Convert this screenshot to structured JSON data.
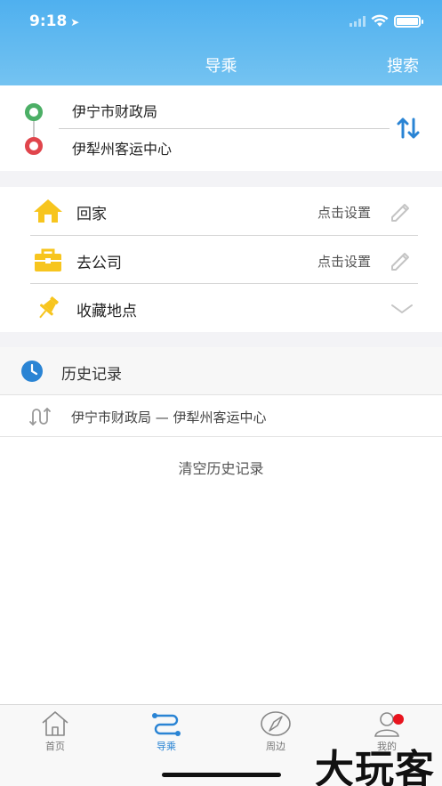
{
  "status_bar": {
    "time": "9:18"
  },
  "header": {
    "title": "导乘",
    "search_label": "搜索"
  },
  "route": {
    "from": "伊宁市财政局",
    "to": "伊犁州客运中心"
  },
  "places": [
    {
      "label": "回家",
      "action": "点击设置",
      "icon": "home-icon"
    },
    {
      "label": "去公司",
      "action": "点击设置",
      "icon": "briefcase-icon"
    },
    {
      "label": "收藏地点",
      "icon": "pin-icon"
    }
  ],
  "history": {
    "title": "历史记录",
    "items": [
      {
        "text": "伊宁市财政局 — 伊犁州客运中心"
      }
    ],
    "clear_label": "清空历史记录"
  },
  "tabbar": {
    "tabs": [
      {
        "label": "首页",
        "icon": "home-outline-icon"
      },
      {
        "label": "导乘",
        "icon": "route-icon",
        "active": true
      },
      {
        "label": "周边",
        "icon": "compass-icon"
      },
      {
        "label": "我的",
        "icon": "user-icon",
        "badge": true
      }
    ]
  },
  "watermark": "大玩客",
  "colors": {
    "header_start": "#4fb0ef",
    "header_end": "#74c3f1",
    "accent": "#2a84d4",
    "start_dot": "#4caf66",
    "end_dot": "#e0454c",
    "icon_yellow": "#f7c51e"
  }
}
